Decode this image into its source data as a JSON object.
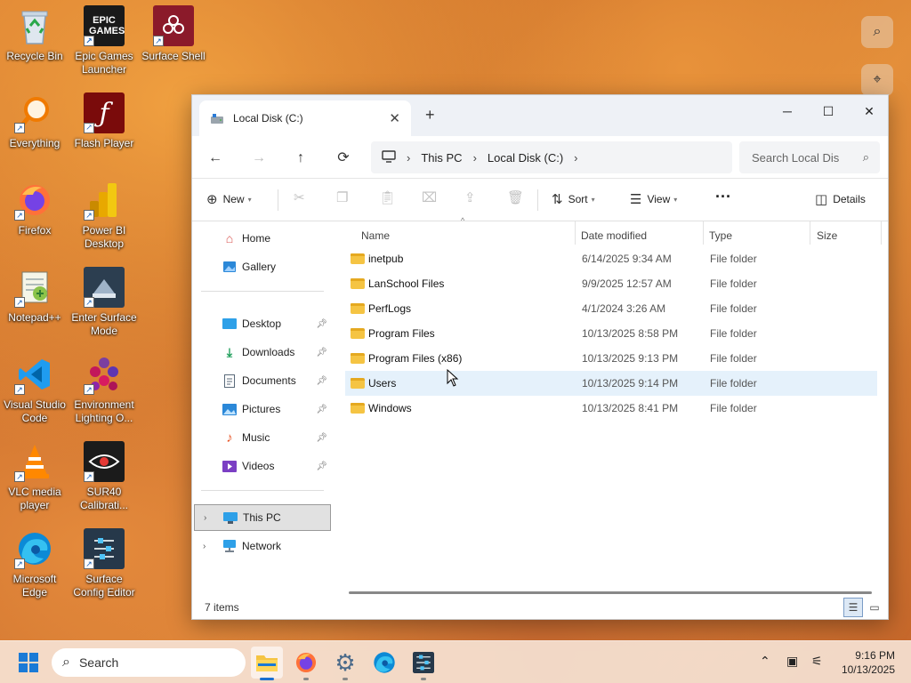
{
  "desktop": {
    "icons": [
      {
        "label": "Recycle Bin",
        "icon": "recycle-bin-icon"
      },
      {
        "label": "Epic Games Launcher",
        "icon": "epic-games-icon"
      },
      {
        "label": "Surface Shell",
        "icon": "surface-shell-icon"
      },
      {
        "label": "Everything",
        "icon": "everything-search-icon"
      },
      {
        "label": "Flash Player",
        "icon": "flash-player-icon"
      },
      {
        "label": "Firefox",
        "icon": "firefox-icon"
      },
      {
        "label": "Power BI Desktop",
        "icon": "power-bi-icon"
      },
      {
        "label": "Notepad++",
        "icon": "notepad-plus-plus-icon"
      },
      {
        "label": "Enter Surface Mode",
        "icon": "surface-mode-icon"
      },
      {
        "label": "Visual Studio Code",
        "icon": "vscode-icon"
      },
      {
        "label": "Environment Lighting O...",
        "icon": "environment-lighting-icon"
      },
      {
        "label": "VLC media player",
        "icon": "vlc-icon"
      },
      {
        "label": "SUR40 Calibrati...",
        "icon": "sur40-calibration-icon"
      },
      {
        "label": "Microsoft Edge",
        "icon": "edge-icon"
      },
      {
        "label": "Surface Config Editor",
        "icon": "surface-config-editor-icon"
      }
    ],
    "epic_logo_text": "EPIC GAMES"
  },
  "window": {
    "tab_title": "Local Disk (C:)",
    "new_tab_glyph": "+",
    "controls": {
      "minimize": "─",
      "maximize": "☐",
      "close": "✕"
    },
    "nav": {
      "back": "←",
      "forward": "→",
      "up": "↑",
      "refresh": "⟳"
    },
    "breadcrumb": [
      "This PC",
      "Local Disk (C:)"
    ],
    "search_placeholder": "Search Local Dis",
    "toolbar": {
      "new_label": "New",
      "sort_label": "Sort",
      "view_label": "View",
      "more_label": "···",
      "details_label": "Details"
    },
    "columns": {
      "name": "Name",
      "date": "Date modified",
      "type": "Type",
      "size": "Size"
    },
    "files": [
      {
        "name": "inetpub",
        "date": "6/14/2025 9:34 AM",
        "type": "File folder"
      },
      {
        "name": "LanSchool Files",
        "date": "9/9/2025 12:57 AM",
        "type": "File folder"
      },
      {
        "name": "PerfLogs",
        "date": "4/1/2024 3:26 AM",
        "type": "File folder"
      },
      {
        "name": "Program Files",
        "date": "10/13/2025 8:58 PM",
        "type": "File folder"
      },
      {
        "name": "Program Files (x86)",
        "date": "10/13/2025 9:13 PM",
        "type": "File folder"
      },
      {
        "name": "Users",
        "date": "10/13/2025 9:14 PM",
        "type": "File folder"
      },
      {
        "name": "Windows",
        "date": "10/13/2025 8:41 PM",
        "type": "File folder"
      }
    ],
    "hovered_row": "Users",
    "nav_pane": {
      "top": [
        {
          "label": "Home",
          "icon": "home-icon"
        },
        {
          "label": "Gallery",
          "icon": "gallery-icon"
        }
      ],
      "pinned": [
        {
          "label": "Desktop",
          "icon": "desktop-folder-icon"
        },
        {
          "label": "Downloads",
          "icon": "downloads-icon"
        },
        {
          "label": "Documents",
          "icon": "documents-icon"
        },
        {
          "label": "Pictures",
          "icon": "pictures-icon"
        },
        {
          "label": "Music",
          "icon": "music-icon"
        },
        {
          "label": "Videos",
          "icon": "videos-icon"
        }
      ],
      "tree": [
        {
          "label": "This PC",
          "icon": "this-pc-icon",
          "selected": true
        },
        {
          "label": "Network",
          "icon": "network-icon",
          "selected": false
        }
      ]
    },
    "status": "7 items"
  },
  "taskbar": {
    "search_label": "Search",
    "apps": [
      "file-explorer-icon",
      "firefox-icon",
      "settings-icon",
      "edge-icon",
      "surface-config-editor-icon"
    ],
    "active_app": "file-explorer-icon",
    "time": "9:16 PM",
    "date": "10/13/2025"
  },
  "colors": {
    "accent": "#1a6fd0",
    "folder": "#f5c443",
    "hover_row": "#e5f1fb",
    "selected_nav": "#e1e1e1"
  }
}
